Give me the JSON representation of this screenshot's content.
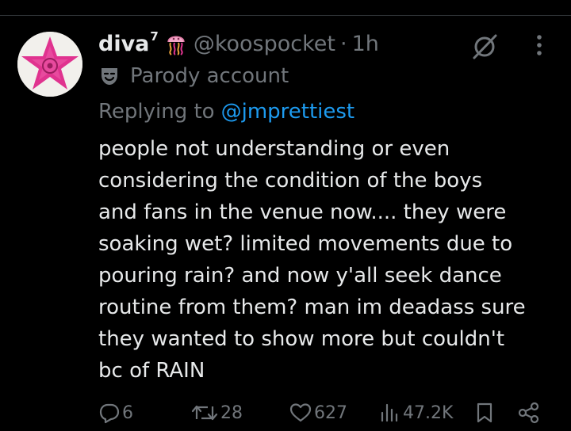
{
  "colors": {
    "background": "#000000",
    "text": "#e7e9ea",
    "muted": "#71767b",
    "link": "#1d9bf0",
    "avatar_star": "#e0338f"
  },
  "tweet": {
    "display_name": "diva",
    "display_name_superscript": "7",
    "name_emoji": "jellyfish-emoji",
    "handle": "@koospocket",
    "separator": "·",
    "time": "1h",
    "parody_label": "Parody account",
    "replying_prefix": "Replying to",
    "replying_to": "@jmprettiest",
    "text_lines": [
      "people not understanding or even",
      "considering the condition of the boys",
      "and fans in the venue now.... they were",
      "soaking wet? limited movements due to",
      "pouring rain? and now y'all seek dance",
      "routine from them? man im deadass sure",
      "they wanted to show more but couldn't",
      "bc of RAIN"
    ]
  },
  "actions": {
    "replies": "6",
    "reposts": "28",
    "likes": "627",
    "views": "47.2K",
    "icons": [
      "reply-icon",
      "repost-icon",
      "like-icon",
      "views-icon",
      "bookmark-icon",
      "share-icon"
    ]
  },
  "header_icons": [
    "grok-icon",
    "more-icon"
  ]
}
